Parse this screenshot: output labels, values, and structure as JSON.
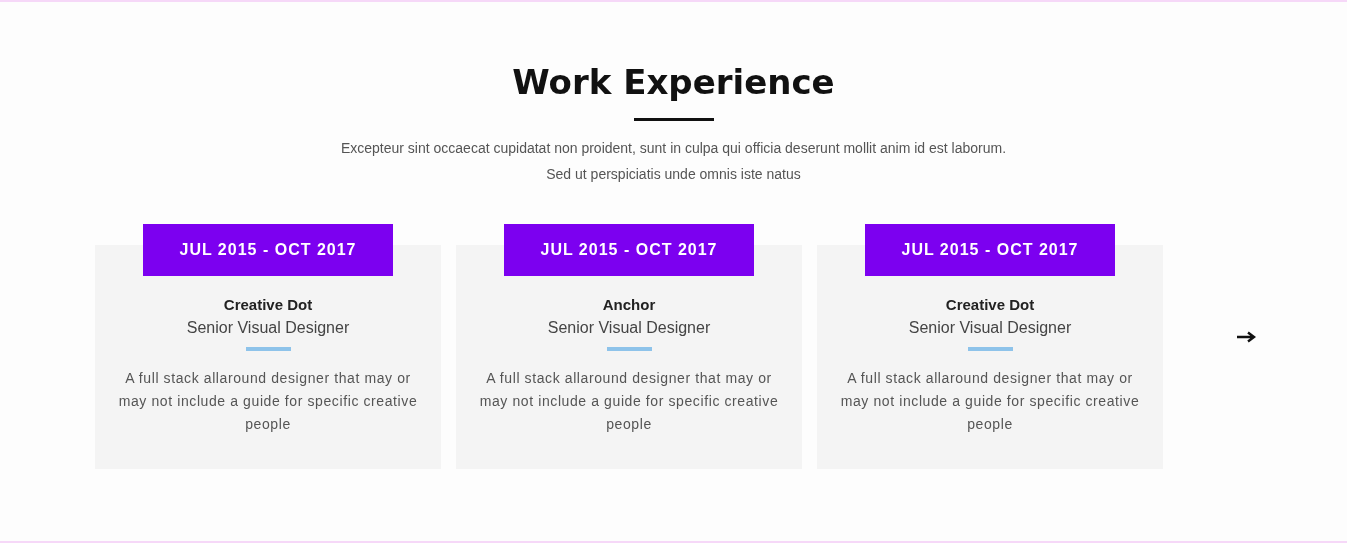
{
  "section": {
    "title": "Work Experience",
    "intro_lines": [
      "Excepteur sint occaecat cupidatat non proident, sunt in culpa qui officia deserunt mollit anim id est laborum.",
      "Sed ut perspiciatis unde omnis iste natus"
    ]
  },
  "cards": [
    {
      "period": "JUL 2015 - OCT 2017",
      "company": "Creative Dot",
      "role": "Senior Visual Designer",
      "description": "A full stack allaround designer that may or may not include a guide for specific creative people"
    },
    {
      "period": "JUL 2015 - OCT 2017",
      "company": "Anchor",
      "role": "Senior Visual Designer",
      "description": "A full stack allaround designer that may or may not include a guide for specific creative people"
    },
    {
      "period": "JUL 2015 - OCT 2017",
      "company": "Creative Dot",
      "role": "Senior Visual Designer",
      "description": "A full stack allaround designer that may or may not include a guide for specific creative people"
    }
  ]
}
